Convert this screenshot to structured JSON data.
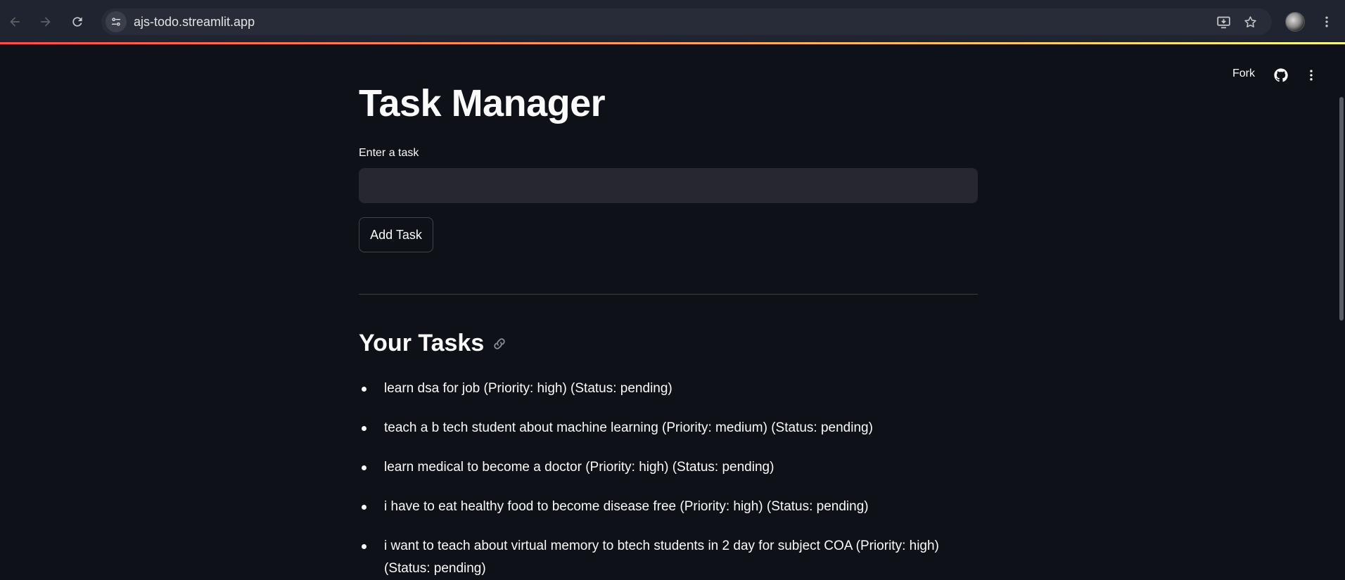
{
  "browser": {
    "url": "ajs-todo.streamlit.app"
  },
  "app_header": {
    "fork_label": "Fork"
  },
  "main": {
    "title": "Task Manager",
    "input_label": "Enter a task",
    "input_value": "",
    "add_button_label": "Add Task",
    "tasks_heading": "Your Tasks",
    "tasks": [
      "learn dsa for job (Priority: high) (Status: pending)",
      "teach a b tech student about machine learning (Priority: medium) (Status: pending)",
      "learn medical to become a doctor (Priority: high) (Status: pending)",
      "i have to eat healthy food to become disease free (Priority: high) (Status: pending)",
      "i want to teach about virtual memory to btech students in 2 day for subject COA (Priority: high) (Status: pending)"
    ]
  },
  "colors": {
    "background": "#0e1117",
    "input_background": "#262730",
    "text": "#fafafa",
    "browser_bar": "#1f2430",
    "accent_gradient_start": "#ff4b4b",
    "accent_gradient_end": "#fffd80"
  },
  "icons": {
    "back": "arrow-left-icon",
    "forward": "arrow-right-icon",
    "reload": "reload-icon",
    "site_info": "tune-icon",
    "install": "install-app-icon",
    "bookmark": "star-icon",
    "profile": "avatar",
    "chrome_menu": "kebab-menu-icon",
    "github": "github-icon",
    "app_menu": "kebab-menu-icon",
    "heading_anchor": "link-icon"
  }
}
